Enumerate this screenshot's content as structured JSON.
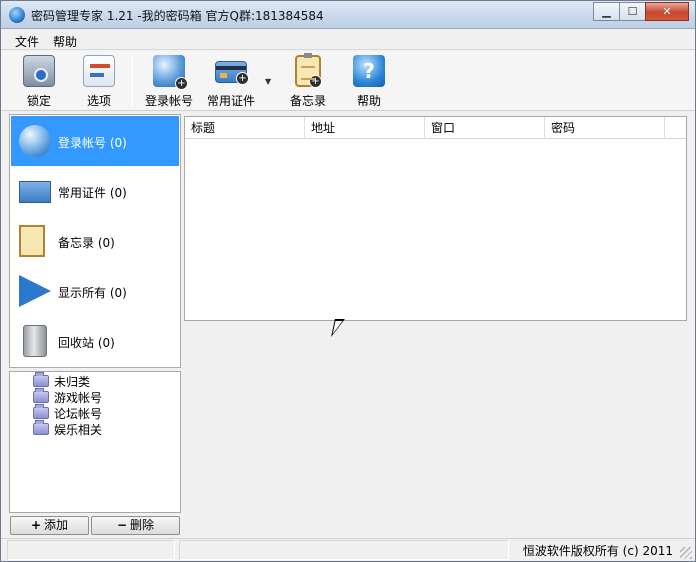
{
  "window": {
    "title": "密码管理专家 1.21 -我的密码箱 官方Q群:181384584",
    "buttons": [
      "minimize",
      "maximize",
      "close"
    ]
  },
  "menubar": {
    "items": [
      "文件",
      "帮助"
    ]
  },
  "toolbar": {
    "lock": {
      "label": "锁定",
      "icon": "lock-icon"
    },
    "options": {
      "label": "选项",
      "icon": "options-icon"
    },
    "login": {
      "label": "登录帐号",
      "icon": "globe-add-icon"
    },
    "cert": {
      "label": "常用证件",
      "icon": "card-add-icon"
    },
    "memo": {
      "label": "备忘录",
      "icon": "memo-add-icon"
    },
    "help": {
      "label": "帮助",
      "icon": "help-icon",
      "glyph": "?"
    }
  },
  "categories": [
    {
      "label": "登录帐号 (0)",
      "icon": "globe-icon",
      "selected": true
    },
    {
      "label": "常用证件 (0)",
      "icon": "card-icon",
      "selected": false
    },
    {
      "label": "备忘录 (0)",
      "icon": "memo-icon",
      "selected": false
    },
    {
      "label": "显示所有 (0)",
      "icon": "arrow-right-icon",
      "selected": false
    },
    {
      "label": "回收站 (0)",
      "icon": "trash-icon",
      "selected": false
    }
  ],
  "groups": [
    {
      "label": "未归类"
    },
    {
      "label": "游戏帐号"
    },
    {
      "label": "论坛帐号"
    },
    {
      "label": "娱乐相关"
    }
  ],
  "group_buttons": {
    "add": {
      "symbol": "+",
      "label": "添加"
    },
    "delete": {
      "symbol": "−",
      "label": "删除"
    }
  },
  "table": {
    "columns": [
      "标题",
      "地址",
      "窗口",
      "密码"
    ],
    "rows": []
  },
  "status": {
    "copyright": "恒波软件版权所有 (c) 2011"
  },
  "colors": {
    "selection": "#3399ff",
    "titlebar": "#c7d7ea"
  }
}
